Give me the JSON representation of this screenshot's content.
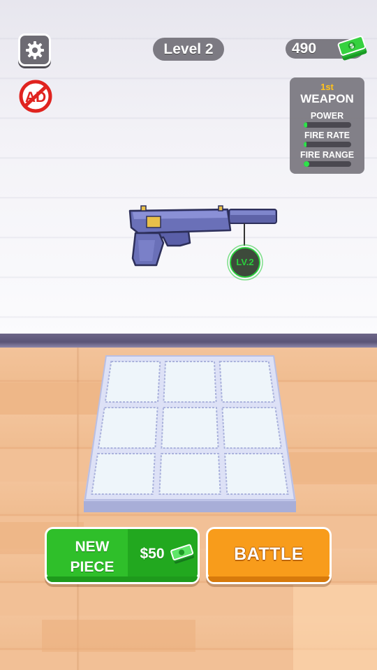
{
  "hud": {
    "level_label": "Level 2",
    "cash_amount": "490",
    "icons": {
      "settings": "gear-icon",
      "no_ads": "no-ads-icon",
      "cash": "cash-stack-icon"
    }
  },
  "weapon_panel": {
    "rank": "1st",
    "title": "WEAPON",
    "stats": [
      {
        "label": "POWER",
        "level": 0.08
      },
      {
        "label": "FIRE RATE",
        "level": 0.05
      },
      {
        "label": "FIRE RANGE",
        "level": 0.12
      }
    ]
  },
  "weapon": {
    "icon": "pistol-icon",
    "level_badge": "LV.2"
  },
  "merge_grid": {
    "rows": 3,
    "cols": 3,
    "cells": [
      "",
      "",
      "",
      "",
      "",
      "",
      "",
      "",
      ""
    ]
  },
  "actions": {
    "new_piece": {
      "label_line1": "NEW",
      "label_line2": "PIECE",
      "price": "$50"
    },
    "battle": {
      "label": "BATTLE"
    }
  },
  "colors": {
    "accent_green": "#2fbf2a",
    "accent_orange": "#f89c1b",
    "stat_bar": "#2ee24a",
    "rank_gold": "#ffc21a",
    "badge_green": "#2bcf3d"
  }
}
